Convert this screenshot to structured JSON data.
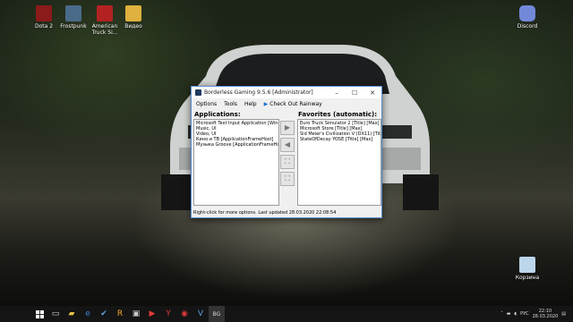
{
  "desktop": {
    "icons_left": [
      {
        "label": "Dota 2",
        "color": "#8b1a1a"
      },
      {
        "label": "Frostpunk",
        "color": "#4a6a8a"
      },
      {
        "label": "American Truck Si...",
        "color": "#b32222"
      },
      {
        "label": "Видео",
        "color": "#e0b040"
      }
    ],
    "icon_right": {
      "label": "Discord",
      "color": "#7289da"
    },
    "recycle_bin": {
      "label": "Корзина",
      "color": "#bcd6ec"
    }
  },
  "window": {
    "title": "Borderless Gaming 9.5.6 [Administrator]",
    "controls": {
      "minimize": "–",
      "maximize": "☐",
      "close": "✕"
    },
    "menu": [
      "Options",
      "Tools",
      "Help"
    ],
    "rainway_label": "Check Out Rainway",
    "applications_title": "Applications:",
    "favorites_title": "Favorites (automatic):",
    "applications": [
      "Microsoft Text Input Application [Windows]",
      "Music, UI",
      "Video, UI",
      "Кино и ТВ [ApplicationFrameHost]",
      "Музыка Groove [ApplicationFrameHost]"
    ],
    "favorites": [
      "Euro Truck Simulator 2 [Title] [Max]",
      "Microsoft Store [Title] [Max]",
      "Sid Meier's Civilization V (DX11) [Title] [Max]",
      "StateOfDecay YOSE [Title] [Max]"
    ],
    "buttons": {
      "add": "▶",
      "remove": "◀",
      "fullscreen": "⛶",
      "restore": "⛶"
    },
    "status": "Right-click for more options. Last updated 28.03.2020 22:08:54"
  },
  "taskbar": {
    "start_icon": "windows-icon",
    "items": [
      {
        "name": "task-view-icon",
        "glyph": "▭",
        "color": "#dddddd"
      },
      {
        "name": "file-explorer-icon",
        "glyph": "▰",
        "color": "#e8c24a"
      },
      {
        "name": "edge-icon",
        "glyph": "e",
        "color": "#3a8ad8"
      },
      {
        "name": "steam-icon",
        "glyph": "✔",
        "color": "#5fa3dc"
      },
      {
        "name": "rockstar-icon",
        "glyph": "R",
        "color": "#f5a623"
      },
      {
        "name": "epic-icon",
        "glyph": "▣",
        "color": "#cccccc"
      },
      {
        "name": "media-icon",
        "glyph": "▶",
        "color": "#e03a3a"
      },
      {
        "name": "yandex-icon",
        "glyph": "Y",
        "color": "#e03a3a"
      },
      {
        "name": "record-icon",
        "glyph": "◉",
        "color": "#e03a3a"
      },
      {
        "name": "vegas-icon",
        "glyph": "V",
        "color": "#5aa0e0"
      },
      {
        "name": "borderless-gaming-icon",
        "glyph": "BG",
        "color": "#dddddd"
      }
    ],
    "language": "РУС",
    "time": "22:10",
    "date": "28.03.2020"
  }
}
